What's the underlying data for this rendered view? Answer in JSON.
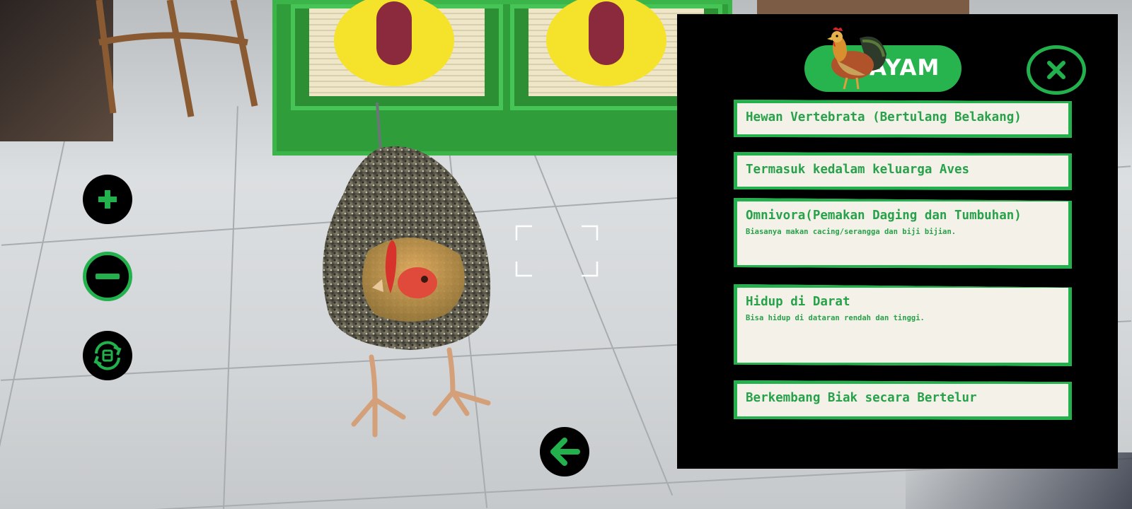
{
  "panel": {
    "title": "AYAM",
    "facts": [
      {
        "title": "Hewan Vertebrata (Bertulang Belakang)",
        "subtitle": ""
      },
      {
        "title": "Termasuk kedalam keluarga Aves",
        "subtitle": ""
      },
      {
        "title": "Omnivora(Pemakan Daging dan Tumbuhan)",
        "subtitle": "Biasanya makan cacing/serangga dan biji bijian."
      },
      {
        "title": "Hidup di Darat",
        "subtitle": "Bisa hidup di dataran rendah dan tinggi."
      },
      {
        "title": "Berkembang Biak secara Bertelur",
        "subtitle": ""
      }
    ]
  },
  "icons": {
    "zoom_in": "plus-icon",
    "zoom_out": "minus-icon",
    "rotate": "rotate-icon",
    "back": "arrow-left-icon",
    "close": "close-icon"
  },
  "colors": {
    "accent_green": "#22b14c",
    "panel_bg": "#000000",
    "card_bg": "#f4f1e8",
    "card_text": "#27a24a"
  }
}
